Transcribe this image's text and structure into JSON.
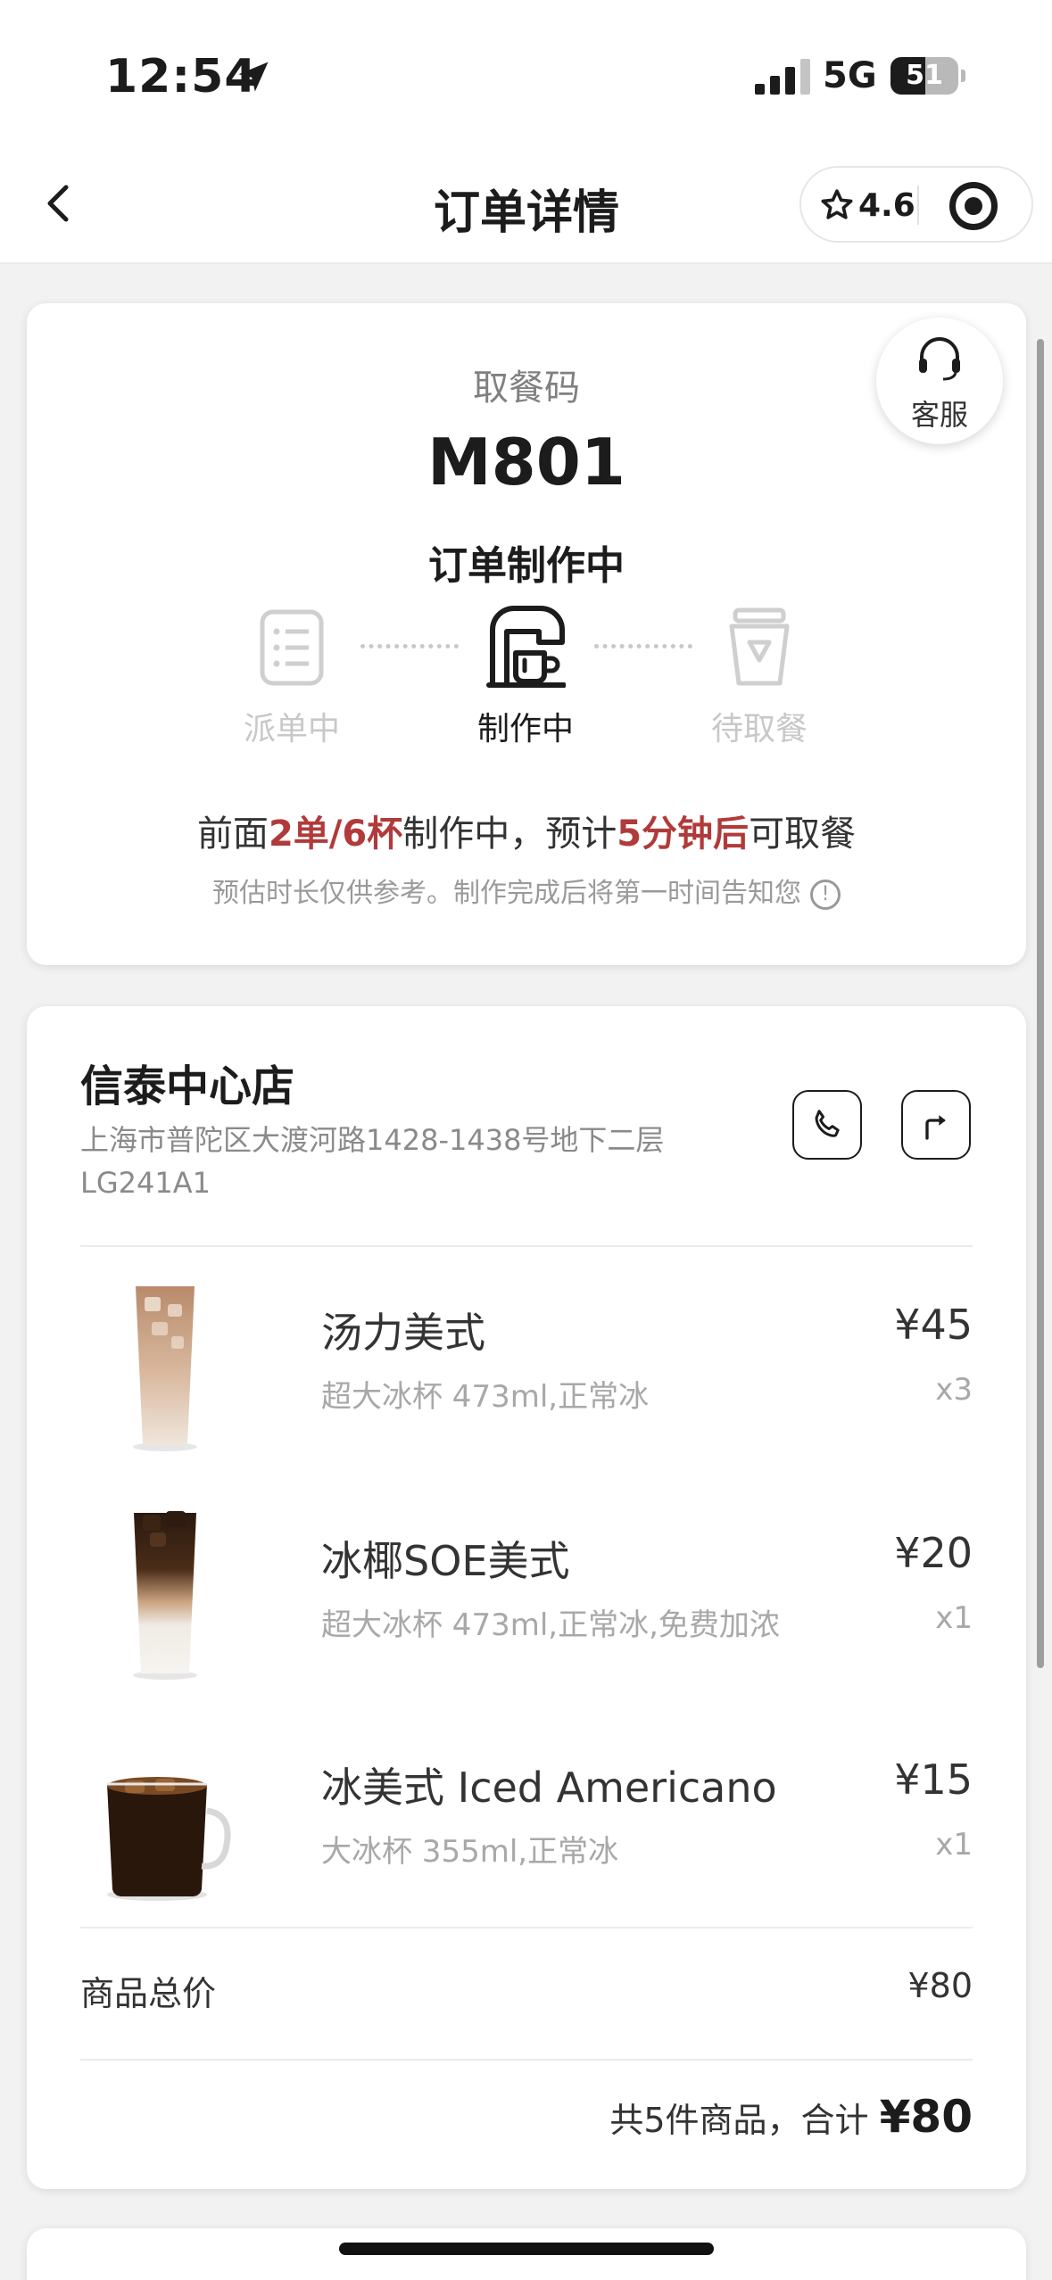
{
  "status_bar": {
    "time": "12:54",
    "network": "5G",
    "battery": "51",
    "battery_level": 0.51,
    "signal_bars": 3,
    "icons": [
      "location-arrow-icon",
      "cellular-signal-icon",
      "battery-icon"
    ]
  },
  "nav": {
    "title": "订单详情",
    "rating": "4.6",
    "icons": [
      "back-chevron-icon",
      "star-icon",
      "target-icon"
    ]
  },
  "pickup": {
    "label": "取餐码",
    "code": "M801",
    "status": "订单制作中",
    "customer_service": "客服",
    "steps": [
      {
        "label": "派单中",
        "active": false,
        "icon": "document-icon"
      },
      {
        "label": "制作中",
        "active": true,
        "icon": "coffee-machine-icon"
      },
      {
        "label": "待取餐",
        "active": false,
        "icon": "cup-icon"
      }
    ],
    "eta": {
      "prefix": "前面",
      "queue": "2单/6杯",
      "middle": "制作中，预计",
      "time": "5分钟后",
      "suffix": "可取餐"
    },
    "note": "预估时长仅供参考。制作完成后将第一时间告知您"
  },
  "store": {
    "name": "信泰中心店",
    "address": "上海市普陀区大渡河路1428-1438号地下二层LG241A1",
    "icons": [
      "phone-icon",
      "directions-icon"
    ]
  },
  "items": [
    {
      "name": "汤力美式",
      "spec": "超大冰杯 473ml,正常冰",
      "price": "¥45",
      "qty": "x3"
    },
    {
      "name": "冰椰SOE美式",
      "spec": "超大冰杯 473ml,正常冰,免费加浓",
      "price": "¥20",
      "qty": "x1"
    },
    {
      "name": "冰美式 Iced Americano",
      "spec": "大冰杯 355ml,正常冰",
      "price": "¥15",
      "qty": "x1"
    }
  ],
  "summary": {
    "subtotal_label": "商品总价",
    "subtotal": "¥80",
    "total_prefix": "共5件商品，合计",
    "total": "¥80"
  },
  "colors": {
    "accent_red": "#b13a3a",
    "background": "#f2f2f2",
    "text_primary": "#1c1c1c",
    "inactive_gray": "#c8c8c8"
  }
}
